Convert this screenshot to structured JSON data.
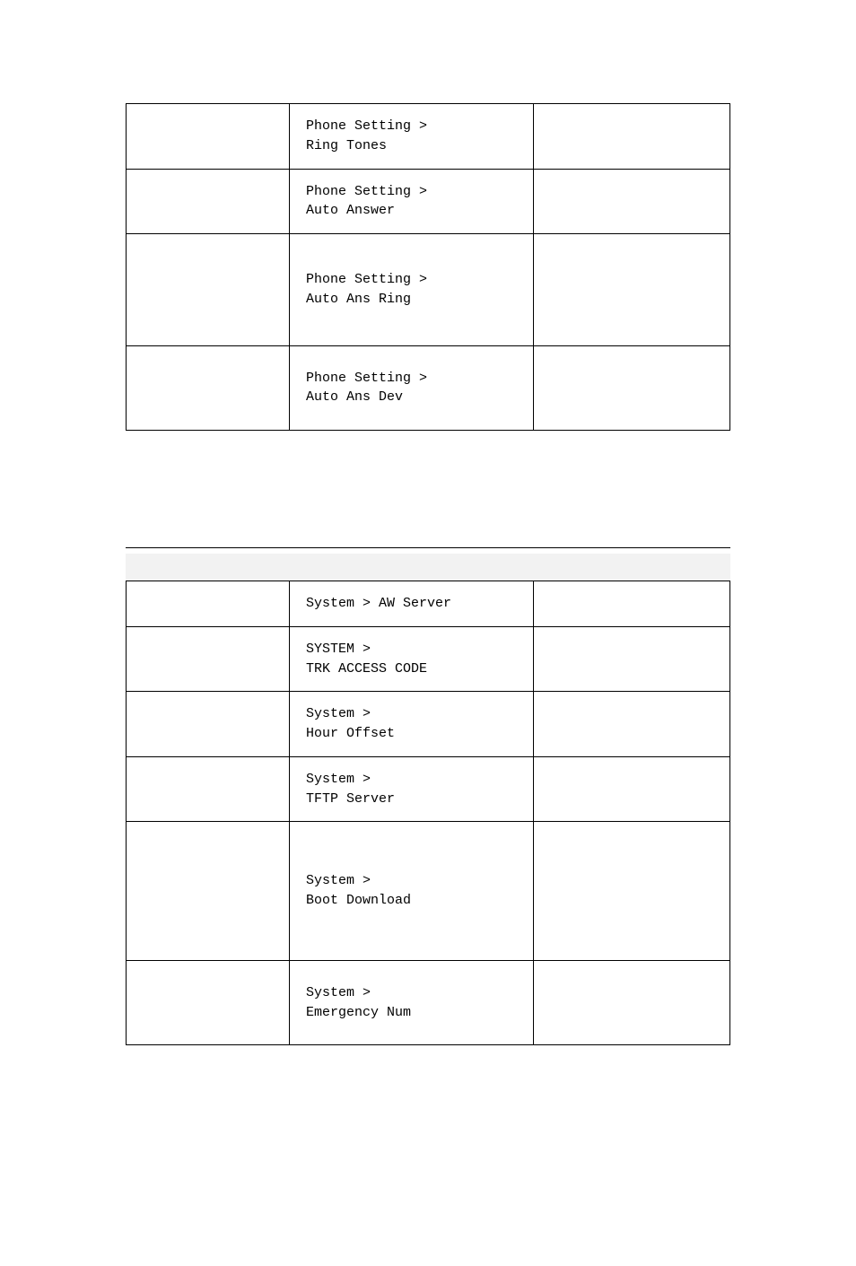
{
  "table1": {
    "rows": [
      {
        "col1": "",
        "col2_line1": "Phone Setting >",
        "col2_line2": "Ring Tones",
        "col3": "",
        "cls": ""
      },
      {
        "col1": "",
        "col2_line1": "Phone Setting >",
        "col2_line2": "Auto Answer",
        "col3": "",
        "cls": ""
      },
      {
        "col1": "",
        "col2_line1": "Phone Setting >",
        "col2_line2": "Auto Ans Ring",
        "col3": "",
        "cls": "tall"
      },
      {
        "col1": "",
        "col2_line1": "Phone Setting >",
        "col2_line2": "Auto Ans Dev",
        "col3": "",
        "cls": "med"
      }
    ]
  },
  "table2": {
    "rows": [
      {
        "col1": "",
        "col2_line1": "System > AW Server",
        "col2_line2": "",
        "col3": "",
        "cls": ""
      },
      {
        "col1": "",
        "col2_line1": "SYSTEM >",
        "col2_line2": "TRK ACCESS CODE",
        "col3": "",
        "cls": ""
      },
      {
        "col1": "",
        "col2_line1": "System >",
        "col2_line2": "Hour Offset",
        "col3": "",
        "cls": ""
      },
      {
        "col1": "",
        "col2_line1": "System >",
        "col2_line2": "TFTP Server",
        "col3": "",
        "cls": ""
      },
      {
        "col1": "",
        "col2_line1": "System >",
        "col2_line2": "Boot Download",
        "col3": "",
        "cls": "xtall"
      },
      {
        "col1": "",
        "col2_line1": "System >",
        "col2_line2": "Emergency Num",
        "col3": "",
        "cls": "med"
      }
    ]
  }
}
